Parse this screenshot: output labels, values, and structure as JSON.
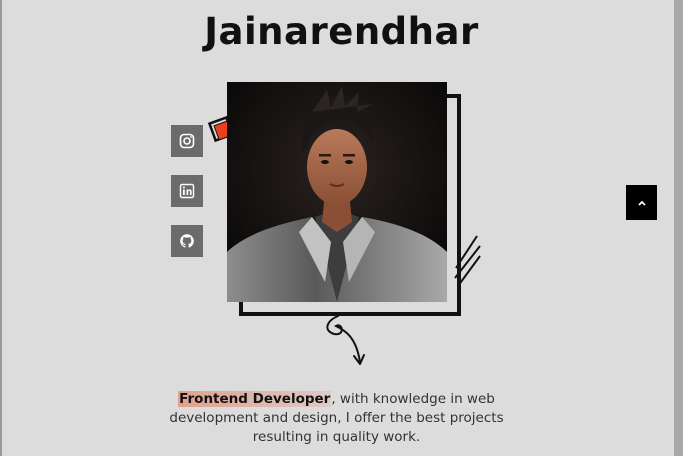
{
  "header": {
    "title": "Jainarendhar"
  },
  "socials": [
    {
      "icon": "instagram-icon"
    },
    {
      "icon": "linkedin-icon"
    },
    {
      "icon": "github-icon"
    }
  ],
  "about": {
    "highlight": "Frontend Developer",
    "text": ", with knowledge in web development and design, I offer the best projects resulting in quality work."
  },
  "colors": {
    "background": "#dcdcdc",
    "accent": "#e8401c",
    "social_bg": "#6b6b6b",
    "scroll_button_bg": "#000000"
  }
}
